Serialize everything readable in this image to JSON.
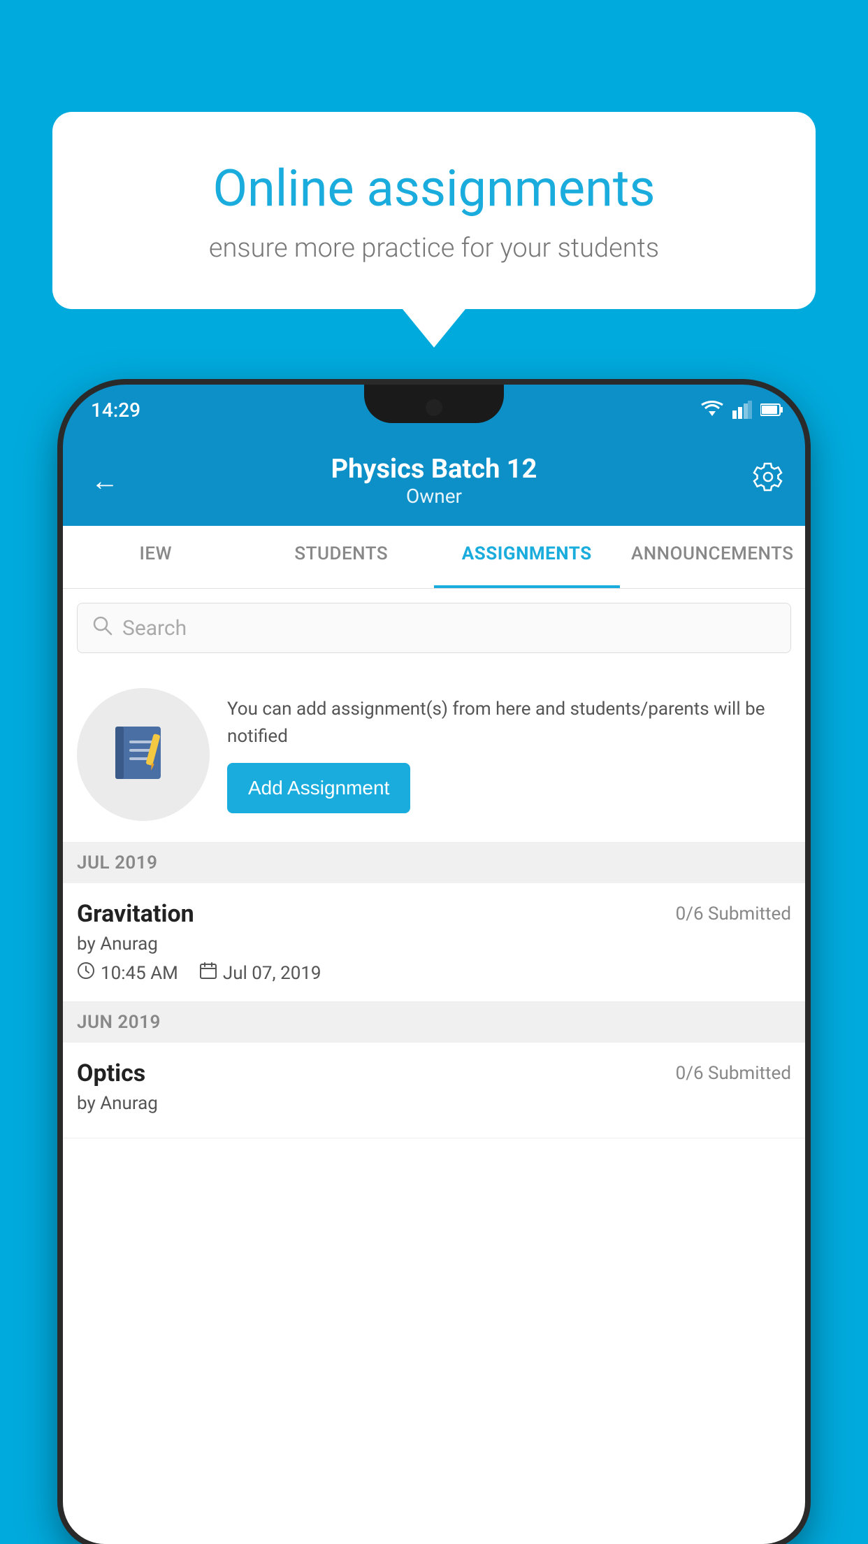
{
  "background_color": "#00AADD",
  "speech_bubble": {
    "title": "Online assignments",
    "subtitle": "ensure more practice for your students"
  },
  "status_bar": {
    "time": "14:29"
  },
  "app_bar": {
    "title": "Physics Batch 12",
    "subtitle": "Owner",
    "back_label": "←",
    "settings_label": "⚙"
  },
  "tabs": [
    {
      "label": "IEW",
      "active": false
    },
    {
      "label": "STUDENTS",
      "active": false
    },
    {
      "label": "ASSIGNMENTS",
      "active": true
    },
    {
      "label": "ANNOUNCEMENTS",
      "active": false
    }
  ],
  "search": {
    "placeholder": "Search"
  },
  "promo": {
    "description": "You can add assignment(s) from here and students/parents will be notified",
    "button_label": "Add Assignment"
  },
  "sections": [
    {
      "header": "JUL 2019",
      "assignments": [
        {
          "title": "Gravitation",
          "status": "0/6 Submitted",
          "by": "by Anurag",
          "time": "10:45 AM",
          "date": "Jul 07, 2019"
        }
      ]
    },
    {
      "header": "JUN 2019",
      "assignments": [
        {
          "title": "Optics",
          "status": "0/6 Submitted",
          "by": "by Anurag",
          "time": "",
          "date": ""
        }
      ]
    }
  ]
}
